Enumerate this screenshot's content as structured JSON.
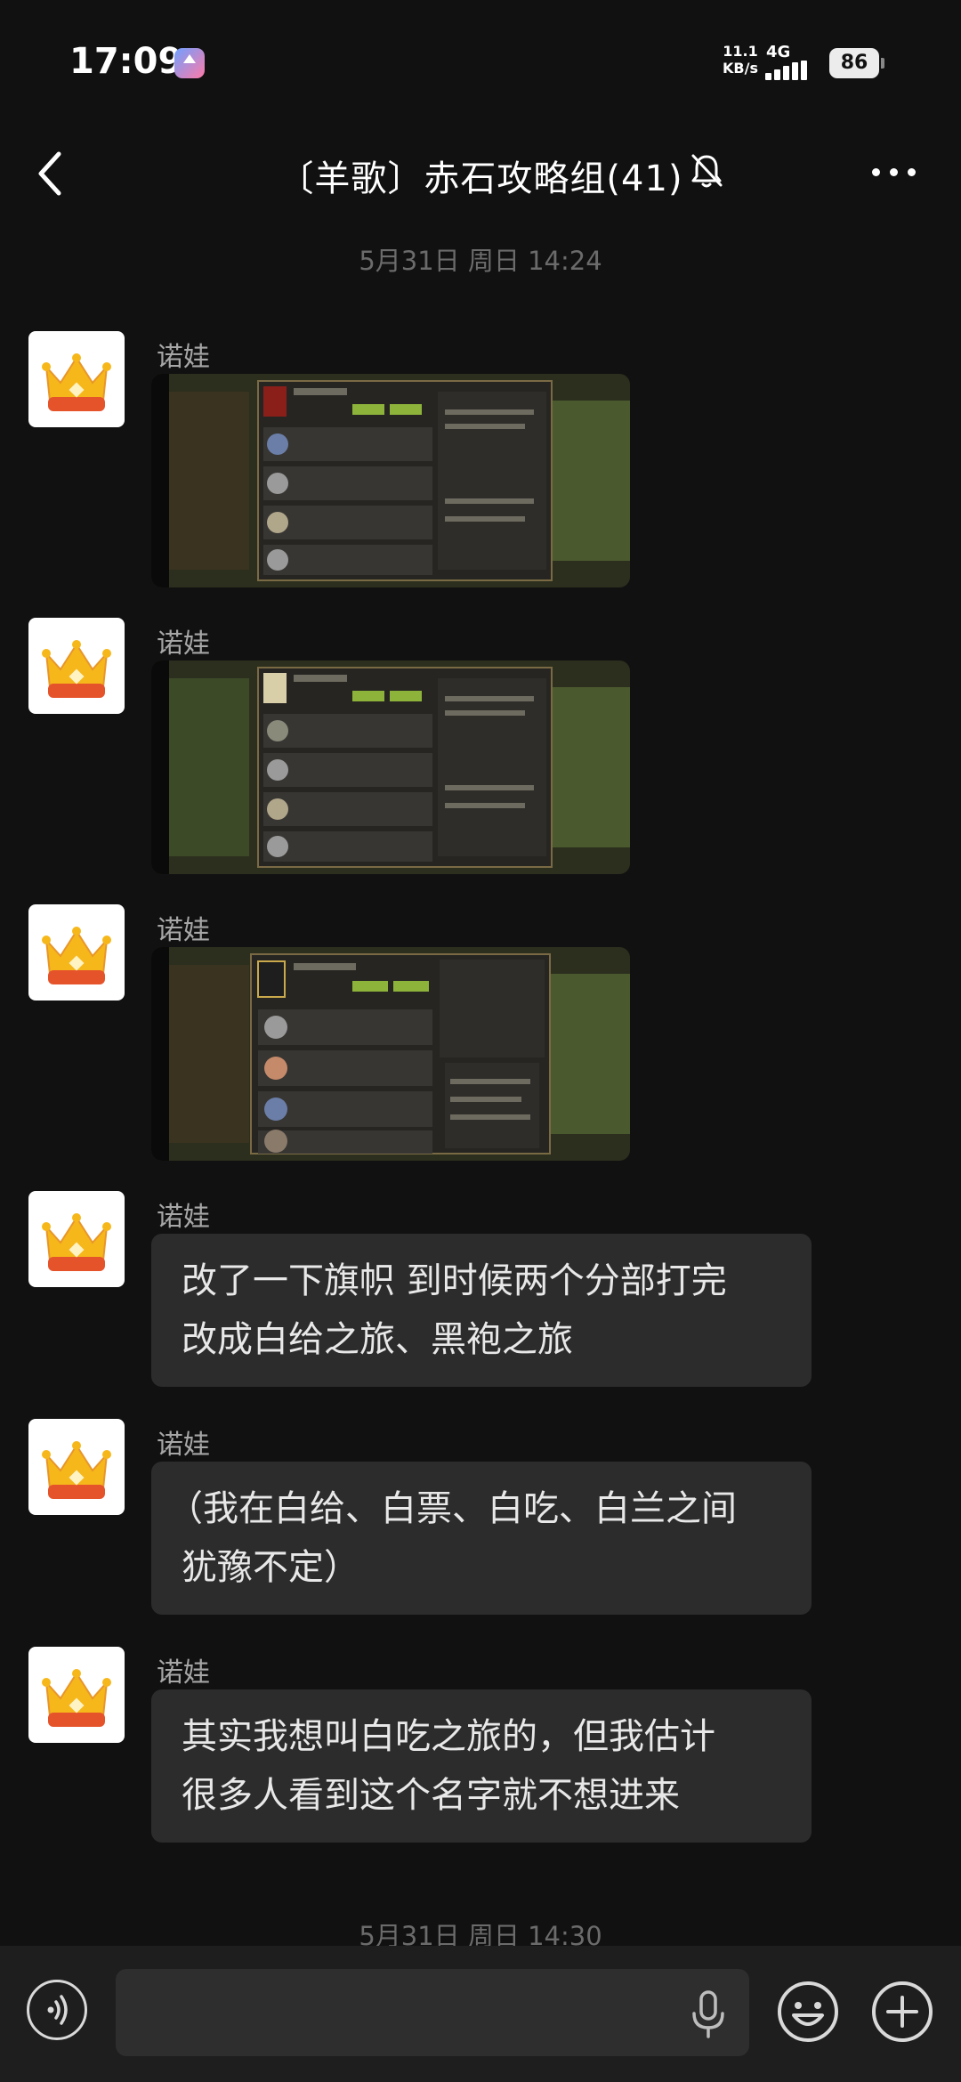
{
  "status_bar": {
    "time": "17:09",
    "net_speed_value": "11.1",
    "net_speed_unit": "KB/s",
    "network": "4G",
    "battery": "86"
  },
  "header": {
    "title": "〔羊歌〕赤石攻略组(41)",
    "back_icon": "back-arrow-icon",
    "mute_icon": "bell-muted-icon",
    "more_icon": "more-dots-icon"
  },
  "timestamps": [
    "5月31日 周日 14:24",
    "5月31日 周日 14:30"
  ],
  "messages": [
    {
      "sender": "诺娃",
      "type": "image",
      "image_alt": "游戏公会成员截图"
    },
    {
      "sender": "诺娃",
      "type": "image",
      "image_alt": "游戏公会成员截图"
    },
    {
      "sender": "诺娃",
      "type": "image",
      "image_alt": "游戏公会成员截图"
    },
    {
      "sender": "诺娃",
      "type": "text",
      "lines": [
        "改了一下旗帜 到时候两个分部打完",
        "改成白给之旅、黑袍之旅"
      ]
    },
    {
      "sender": "诺娃",
      "type": "text",
      "lines": [
        "（我在白给、白票、白吃、白兰之间",
        "犹豫不定）"
      ]
    },
    {
      "sender": "诺娃",
      "type": "text",
      "lines": [
        "其实我想叫白吃之旅的，但我估计",
        "很多人看到这个名字就不想进来"
      ]
    }
  ],
  "input_bar": {
    "placeholder": "",
    "voice_icon": "voice-icon",
    "mic_icon": "mic-icon",
    "emoji_icon": "emoji-icon",
    "plus_icon": "plus-icon"
  },
  "colors": {
    "background": "#111111",
    "bubble": "#2c2c2c",
    "input_bar": "#1e1e1e",
    "crown_gold": "#f4b400",
    "crown_red": "#e5532b"
  }
}
